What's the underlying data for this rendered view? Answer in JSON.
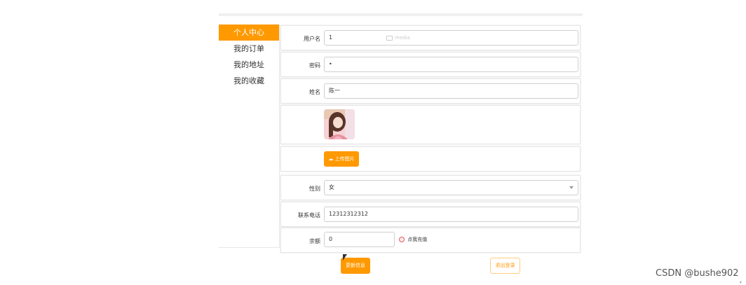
{
  "sidebar": {
    "items": [
      {
        "label": "个人中心"
      },
      {
        "label": "我的订单"
      },
      {
        "label": "我的地址"
      },
      {
        "label": "我的收藏"
      }
    ]
  },
  "form": {
    "username_label": "用户名",
    "username_value": "1",
    "username_hint": "media",
    "password_label": "密码",
    "password_value": "•",
    "name_label": "姓名",
    "name_value": "陈一",
    "upload_button": "上传图片",
    "gender_label": "性别",
    "gender_value": "女",
    "phone_label": "联系电话",
    "phone_value": "12312312312",
    "balance_label": "余额",
    "balance_value": "0",
    "recharge_label": "点我充值"
  },
  "actions": {
    "update_label": "更新信息",
    "logout_label": "退出登录"
  },
  "watermark": "CSDN @bushe902",
  "corner_glyph": "⸗",
  "colors": {
    "accent": "#ff9900",
    "border": "#cfcfcf"
  }
}
